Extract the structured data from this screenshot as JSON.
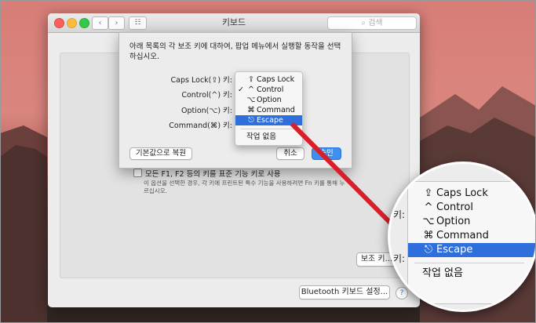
{
  "window": {
    "title": "키보드",
    "search_placeholder": "검색",
    "option_f_keys_label": "모든 F1, F2 등의 키를 표준 기능 키로 사용",
    "option_f_keys_desc": "이 옵션을 선택한 경우, 각 키에 프린트된 특수 기능을 사용하려면 Fn 키를 통해 누르십시오.",
    "modifier_keys_button": "보조 키...",
    "bluetooth_button": "Bluetooth 키보드 설정...",
    "help": "?"
  },
  "sheet": {
    "instruction": "아래 목록의 각 보조 키에 대하여, 팝업 메뉴에서 실행할 동작을 선택하십시오.",
    "rows": [
      {
        "label": "Caps Lock(⇪) 키:"
      },
      {
        "label": "Control(^) 키:"
      },
      {
        "label": "Option(⌥) 키:"
      },
      {
        "label": "Command(⌘) 키:"
      }
    ],
    "restore_button": "기본값으로 복원",
    "cancel_button": "취소",
    "ok_button": "승인"
  },
  "menu": {
    "items": [
      {
        "glyph": "⇪",
        "label": "Caps Lock",
        "checked": false,
        "highlighted": false
      },
      {
        "glyph": "^",
        "label": "Control",
        "checked": true,
        "highlighted": false
      },
      {
        "glyph": "⌥",
        "label": "Option",
        "checked": false,
        "highlighted": false
      },
      {
        "glyph": "⌘",
        "label": "Command",
        "checked": false,
        "highlighted": false
      },
      {
        "glyph": "⎋",
        "label": "Escape",
        "checked": false,
        "highlighted": true
      }
    ],
    "no_action": "작업 없음",
    "check_mark": "✓"
  },
  "zoom": {
    "key_suffix": "키:",
    "button_fragment": "보조 키"
  },
  "colors": {
    "accent": "#2e6fdc",
    "arrow": "#d8202a"
  }
}
